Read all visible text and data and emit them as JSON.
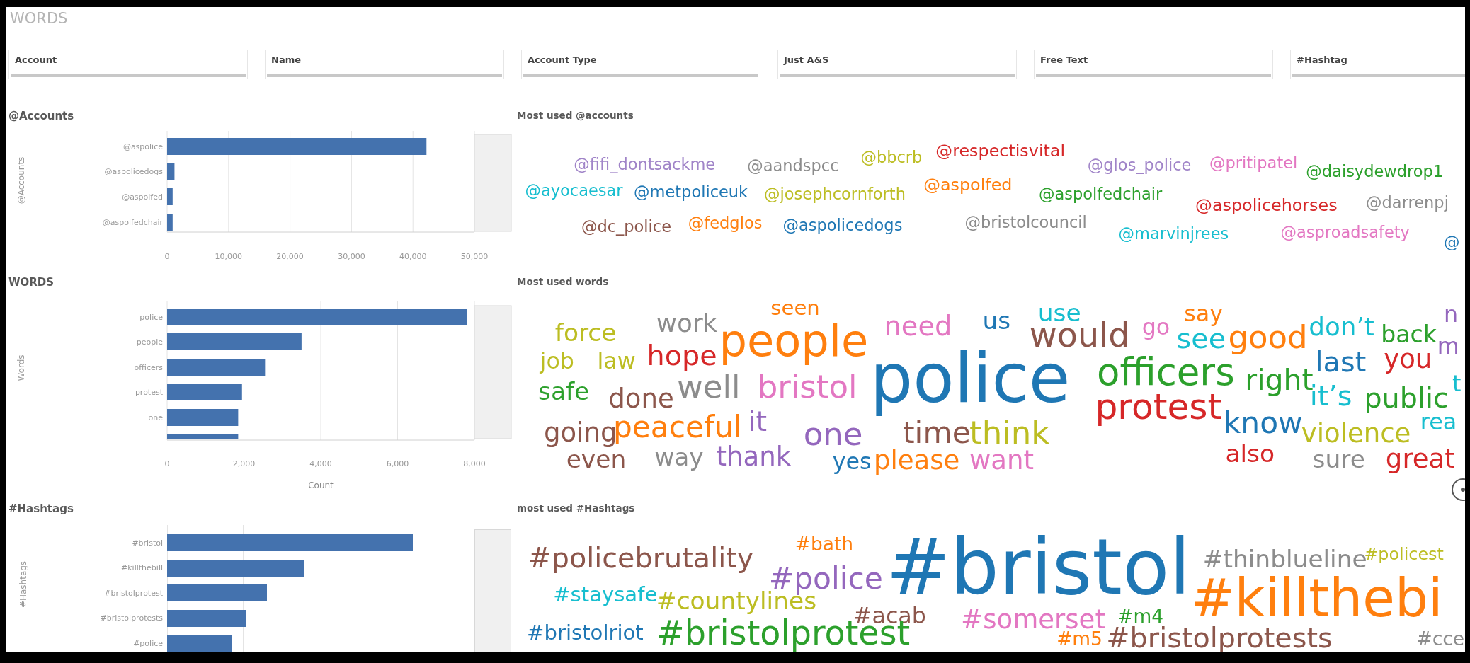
{
  "page_title": "WORDS",
  "filters": [
    {
      "label": "Account"
    },
    {
      "label": "Name"
    },
    {
      "label": "Account Type"
    },
    {
      "label": "Just A&S"
    },
    {
      "label": "Free Text"
    },
    {
      "label": "#Hashtag"
    }
  ],
  "panels": [
    {
      "title": "@Accounts",
      "chart_data": {
        "type": "bar",
        "orientation": "horizontal",
        "ylabel": "@Accounts",
        "categories": [
          "@aspolice",
          "@aspolicedogs",
          "@aspolfed",
          "@aspolfedchair"
        ],
        "values": [
          42200,
          1200,
          900,
          900
        ],
        "grid": true,
        "xlim": [
          0,
          50000
        ],
        "xticks": [
          {
            "value": 0,
            "label": "0"
          },
          {
            "value": 10000,
            "label": "10,000"
          },
          {
            "value": 20000,
            "label": "20,000"
          },
          {
            "value": 30000,
            "label": "30,000"
          },
          {
            "value": 40000,
            "label": "40,000"
          },
          {
            "value": 50000,
            "label": "50,000"
          }
        ]
      }
    },
    {
      "title": "WORDS",
      "chart_data": {
        "type": "bar",
        "orientation": "horizontal",
        "ylabel": "Words",
        "xlabel": "Count",
        "categories": [
          "police",
          "people",
          "officers",
          "protest",
          "one",
          null
        ],
        "values": [
          7800,
          3500,
          2550,
          1950,
          1850,
          1850
        ],
        "grid": true,
        "xlim": [
          0,
          8000
        ],
        "xticks": [
          {
            "value": 0,
            "label": "0"
          },
          {
            "value": 2000,
            "label": "2,000"
          },
          {
            "value": 4000,
            "label": "4,000"
          },
          {
            "value": 6000,
            "label": "6,000"
          },
          {
            "value": 8000,
            "label": "8,000"
          }
        ]
      }
    },
    {
      "title": "#Hashtags",
      "axis_title": "#Hashtags",
      "bars": [
        {
          "label": "#bristol"
        },
        {
          "label": "#killthebill"
        },
        {
          "label": "#bristolprotest"
        },
        {
          "label": "#bristolprotests"
        },
        {
          "label": "#police"
        }
      ]
    }
  ],
  "clouds": [
    {
      "title": "Most used @accounts",
      "words": [
        {
          "text": "@fifi_dontsackme",
          "color": "#a084c8"
        },
        {
          "text": "@aandspcc",
          "color": "#8c8c8c"
        },
        {
          "text": "@bbcrb",
          "color": "#bcbd22"
        },
        {
          "text": "@respectisvital",
          "color": "#d62728"
        },
        {
          "text": "@glos_police",
          "color": "#a084c8"
        },
        {
          "text": "@pritipatel",
          "color": "#e377c2"
        },
        {
          "text": "@daisydewdrop1",
          "color": "#2ca02c"
        },
        {
          "text": "@ayocaesar",
          "color": "#17becf"
        },
        {
          "text": "@metpoliceuk",
          "color": "#1f77b4"
        },
        {
          "text": "@josephcornforth",
          "color": "#bcbd22"
        },
        {
          "text": "@aspolfed",
          "color": "#ff7f0e"
        },
        {
          "text": "@aspolfedchair",
          "color": "#2ca02c"
        },
        {
          "text": "@aspolicehorses",
          "color": "#d62728"
        },
        {
          "text": "@darrenpj",
          "color": "#8c8c8c"
        },
        {
          "text": "@dc_police",
          "color": "#8c564b"
        },
        {
          "text": "@fedglos",
          "color": "#ff7f0e"
        },
        {
          "text": "@aspolicedogs",
          "color": "#1f77b4"
        },
        {
          "text": "@bristolcouncil",
          "color": "#8c8c8c"
        },
        {
          "text": "@marvinjrees",
          "color": "#17becf"
        },
        {
          "text": "@asproadsafety",
          "color": "#e377c2"
        },
        {
          "text": "@",
          "color": "#1f77b4"
        }
      ]
    },
    {
      "title": "Most used words",
      "words": [
        {
          "text": "force",
          "color": "#bcbd22"
        },
        {
          "text": "work",
          "color": "#8c8c8c"
        },
        {
          "text": "seen",
          "color": "#ff7f0e"
        },
        {
          "text": "people",
          "color": "#ff7f0e"
        },
        {
          "text": "need",
          "color": "#e377c2"
        },
        {
          "text": "us",
          "color": "#1f77b4"
        },
        {
          "text": "use",
          "color": "#17becf"
        },
        {
          "text": "would",
          "color": "#8c564b"
        },
        {
          "text": "go",
          "color": "#e377c2"
        },
        {
          "text": "say",
          "color": "#ff7f0e"
        },
        {
          "text": "see",
          "color": "#17becf"
        },
        {
          "text": "good",
          "color": "#ff7f0e"
        },
        {
          "text": "don’t",
          "color": "#17becf"
        },
        {
          "text": "back",
          "color": "#2ca02c"
        },
        {
          "text": "n",
          "color": "#9467bd"
        },
        {
          "text": "job",
          "color": "#bcbd22"
        },
        {
          "text": "law",
          "color": "#bcbd22"
        },
        {
          "text": "hope",
          "color": "#d62728"
        },
        {
          "text": "police",
          "color": "#1f77b4"
        },
        {
          "text": "officers",
          "color": "#2ca02c"
        },
        {
          "text": "right",
          "color": "#2ca02c"
        },
        {
          "text": "last",
          "color": "#1f77b4"
        },
        {
          "text": "you",
          "color": "#d62728"
        },
        {
          "text": "m",
          "color": "#9467bd"
        },
        {
          "text": "safe",
          "color": "#2ca02c"
        },
        {
          "text": "done",
          "color": "#8c564b"
        },
        {
          "text": "well",
          "color": "#8c8c8c"
        },
        {
          "text": "bristol",
          "color": "#e377c2"
        },
        {
          "text": "protest",
          "color": "#d62728"
        },
        {
          "text": "it’s",
          "color": "#17becf"
        },
        {
          "text": "public",
          "color": "#2ca02c"
        },
        {
          "text": "t",
          "color": "#17becf"
        },
        {
          "text": "going",
          "color": "#8c564b"
        },
        {
          "text": "peaceful",
          "color": "#ff7f0e"
        },
        {
          "text": "it",
          "color": "#9467bd"
        },
        {
          "text": "one",
          "color": "#9467bd"
        },
        {
          "text": "time",
          "color": "#8c564b"
        },
        {
          "text": "think",
          "color": "#bcbd22"
        },
        {
          "text": "know",
          "color": "#1f77b4"
        },
        {
          "text": "violence",
          "color": "#bcbd22"
        },
        {
          "text": "rea",
          "color": "#17becf"
        },
        {
          "text": "even",
          "color": "#8c564b"
        },
        {
          "text": "way",
          "color": "#8c8c8c"
        },
        {
          "text": "thank",
          "color": "#9467bd"
        },
        {
          "text": "yes",
          "color": "#1f77b4"
        },
        {
          "text": "please",
          "color": "#ff7f0e"
        },
        {
          "text": "want",
          "color": "#e377c2"
        },
        {
          "text": "also",
          "color": "#d62728"
        },
        {
          "text": "sure",
          "color": "#8c8c8c"
        },
        {
          "text": "great",
          "color": "#d62728"
        }
      ]
    },
    {
      "title": "most used #Hashtags",
      "words": [
        {
          "text": "#policebrutality",
          "color": "#8c564b"
        },
        {
          "text": "#bath",
          "color": "#ff7f0e"
        },
        {
          "text": "#police",
          "color": "#9467bd"
        },
        {
          "text": "#bristol",
          "color": "#1f77b4"
        },
        {
          "text": "#thinblueline",
          "color": "#8c8c8c"
        },
        {
          "text": "#policest",
          "color": "#bcbd22"
        },
        {
          "text": "#staysafe",
          "color": "#17becf"
        },
        {
          "text": "#countylines",
          "color": "#bcbd22"
        },
        {
          "text": "#acab",
          "color": "#8c564b"
        },
        {
          "text": "#killthebi",
          "color": "#ff7f0e"
        },
        {
          "text": "#bristolriot",
          "color": "#1f77b4"
        },
        {
          "text": "#bristolprotest",
          "color": "#2ca02c"
        },
        {
          "text": "#somerset",
          "color": "#e377c2"
        },
        {
          "text": "#m4",
          "color": "#2ca02c"
        },
        {
          "text": "#m5",
          "color": "#ff7f0e"
        },
        {
          "text": "#bristolprotests",
          "color": "#8c564b"
        },
        {
          "text": "#cce",
          "color": "#8c8c8c"
        }
      ]
    }
  ]
}
